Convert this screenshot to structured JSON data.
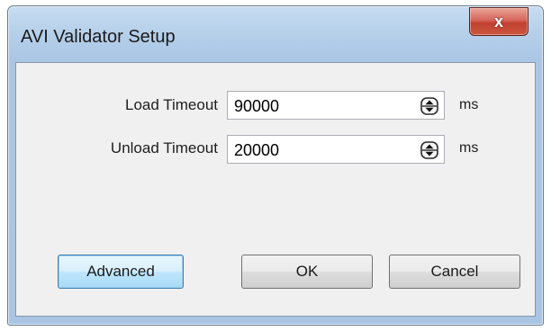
{
  "window": {
    "title": "AVI Validator Setup",
    "close_label": "x"
  },
  "form": {
    "load_timeout": {
      "label": "Load Timeout",
      "value": "90000",
      "unit": "ms"
    },
    "unload_timeout": {
      "label": "Unload Timeout",
      "value": "20000",
      "unit": "ms"
    }
  },
  "buttons": {
    "advanced": "Advanced",
    "ok": "OK",
    "cancel": "Cancel"
  },
  "icons": {
    "close": "close-icon",
    "spin": "spin-updown-icon"
  },
  "colors": {
    "titlebar": "#b6d0ea",
    "close_button": "#c24130",
    "client_bg": "#f0f0f0",
    "focus_button": "#bee6fd"
  }
}
